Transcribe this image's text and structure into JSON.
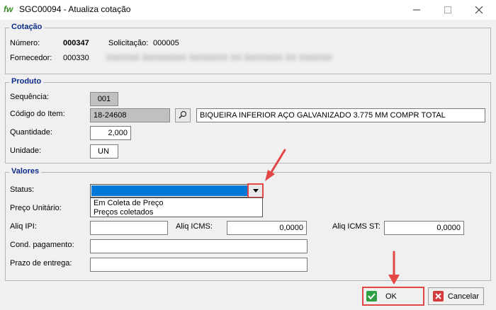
{
  "window": {
    "app_logo": "fw",
    "title": "SGC00094 - Atualiza cotação"
  },
  "cotacao": {
    "group_title": "Cotação",
    "numero_label": "Número:",
    "numero_value": "000347",
    "solicitacao_label": "Solicitação:",
    "solicitacao_value": "000005",
    "fornecedor_label": "Fornecedor:",
    "fornecedor_code": "000330",
    "fornecedor_name": "XXXXXX XXXXXXXX XXXXXXX XX XXXXXXX XX XXXXXXXXXXXX XXXX"
  },
  "produto": {
    "group_title": "Produto",
    "sequencia_label": "Sequência:",
    "sequencia_value": "001",
    "codigo_label": "Código do Item:",
    "codigo_value": "18-24608",
    "descricao_value": "BIQUEIRA INFERIOR AÇO GALVANIZADO  3.775 MM COMPR TOTAL",
    "quantidade_label": "Quantidade:",
    "quantidade_value": "2,000",
    "unidade_label": "Unidade:",
    "unidade_value": "UN"
  },
  "valores": {
    "group_title": "Valores",
    "status_label": "Status:",
    "status_options": [
      "Em Coleta de Preço",
      "Preços coletados"
    ],
    "preco_label": "Preço Unitário:",
    "aliq_ipi_label": "Aliq IPI:",
    "aliq_ipi_value": "",
    "aliq_icms_label": "Aliq ICMS:",
    "aliq_icms_value": "0,0000",
    "aliq_icms_st_label": "Aliq ICMS ST:",
    "aliq_icms_st_value": "0,0000",
    "cond_pagamento_label": "Cond. pagamento:",
    "cond_pagamento_value": "",
    "prazo_label": "Prazo de entrega:",
    "prazo_value": ""
  },
  "buttons": {
    "ok_label": "OK",
    "cancel_label": "Cancelar"
  },
  "colors": {
    "group_title": "#0a2a8a",
    "highlight_red": "#e24646",
    "selection_blue": "#0078d7"
  }
}
